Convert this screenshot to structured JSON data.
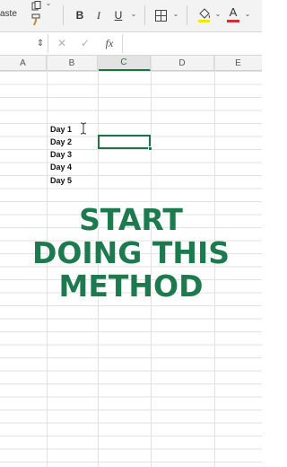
{
  "ribbon": {
    "paste_label": "aste",
    "bold": "B",
    "italic": "I",
    "underline": "U",
    "font_color_letter": "A",
    "chevron": "⌄"
  },
  "formula_bar": {
    "cancel": "✕",
    "confirm": "✓",
    "fx": "fx",
    "stepper": "⇕"
  },
  "columns": [
    "A",
    "B",
    "C",
    "D",
    "E"
  ],
  "active_column": "C",
  "cells": [
    "Day 1",
    "Day 2",
    "Day 3",
    "Day 4",
    "Day 5"
  ],
  "overlay": [
    "START",
    "DOING THIS",
    "METHOD"
  ],
  "colors": {
    "accent": "#217346",
    "overlay_text": "#1d7a4f",
    "highlight_yellow": "#f5e800",
    "font_red": "#d32f2f"
  }
}
